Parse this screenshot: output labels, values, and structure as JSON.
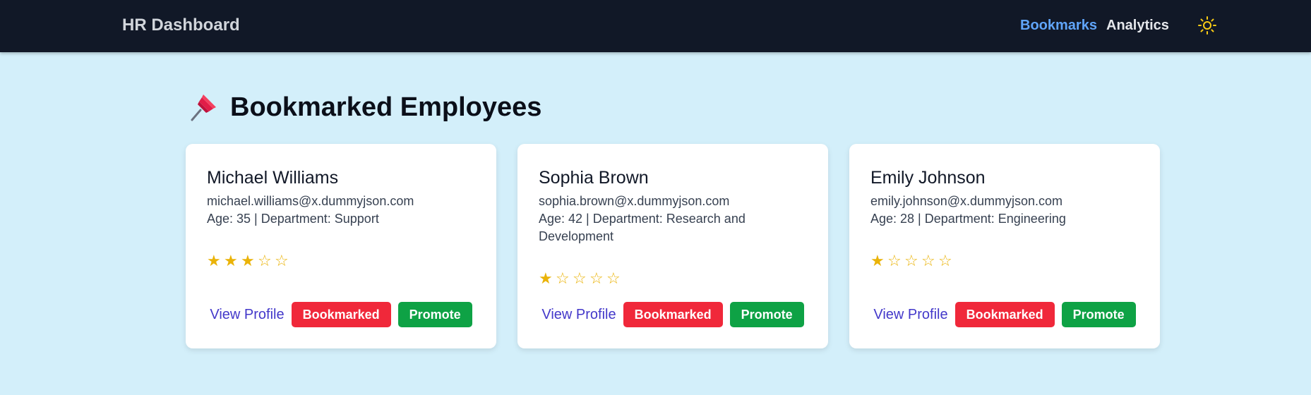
{
  "nav": {
    "brand": "HR Dashboard",
    "links": [
      {
        "label": "Bookmarks",
        "active": true
      },
      {
        "label": "Analytics",
        "active": false
      }
    ],
    "theme_icon": "sun-icon"
  },
  "page": {
    "title_icon": "pushpin-icon",
    "title": "Bookmarked Employees"
  },
  "employees": [
    {
      "name": "Michael Williams",
      "email": "michael.williams@x.dummyjson.com",
      "meta": "Age: 35 | Department: Support",
      "rating": 3,
      "max_rating": 5,
      "view_label": "View Profile",
      "bookmark_label": "Bookmarked",
      "promote_label": "Promote"
    },
    {
      "name": "Sophia Brown",
      "email": "sophia.brown@x.dummyjson.com",
      "meta": "Age: 42 | Department: Research and Development",
      "rating": 1,
      "max_rating": 5,
      "view_label": "View Profile",
      "bookmark_label": "Bookmarked",
      "promote_label": "Promote"
    },
    {
      "name": "Emily Johnson",
      "email": "emily.johnson@x.dummyjson.com",
      "meta": "Age: 28 | Department: Engineering",
      "rating": 1,
      "max_rating": 5,
      "view_label": "View Profile",
      "bookmark_label": "Bookmarked",
      "promote_label": "Promote"
    }
  ],
  "colors": {
    "navbar_bg": "#111827",
    "page_bg": "#d3effa",
    "active_link": "#60a5fa",
    "star": "#eab308",
    "bookmark_button": "#f0283a",
    "promote_button": "#0ea245",
    "view_link": "#4338ca"
  }
}
